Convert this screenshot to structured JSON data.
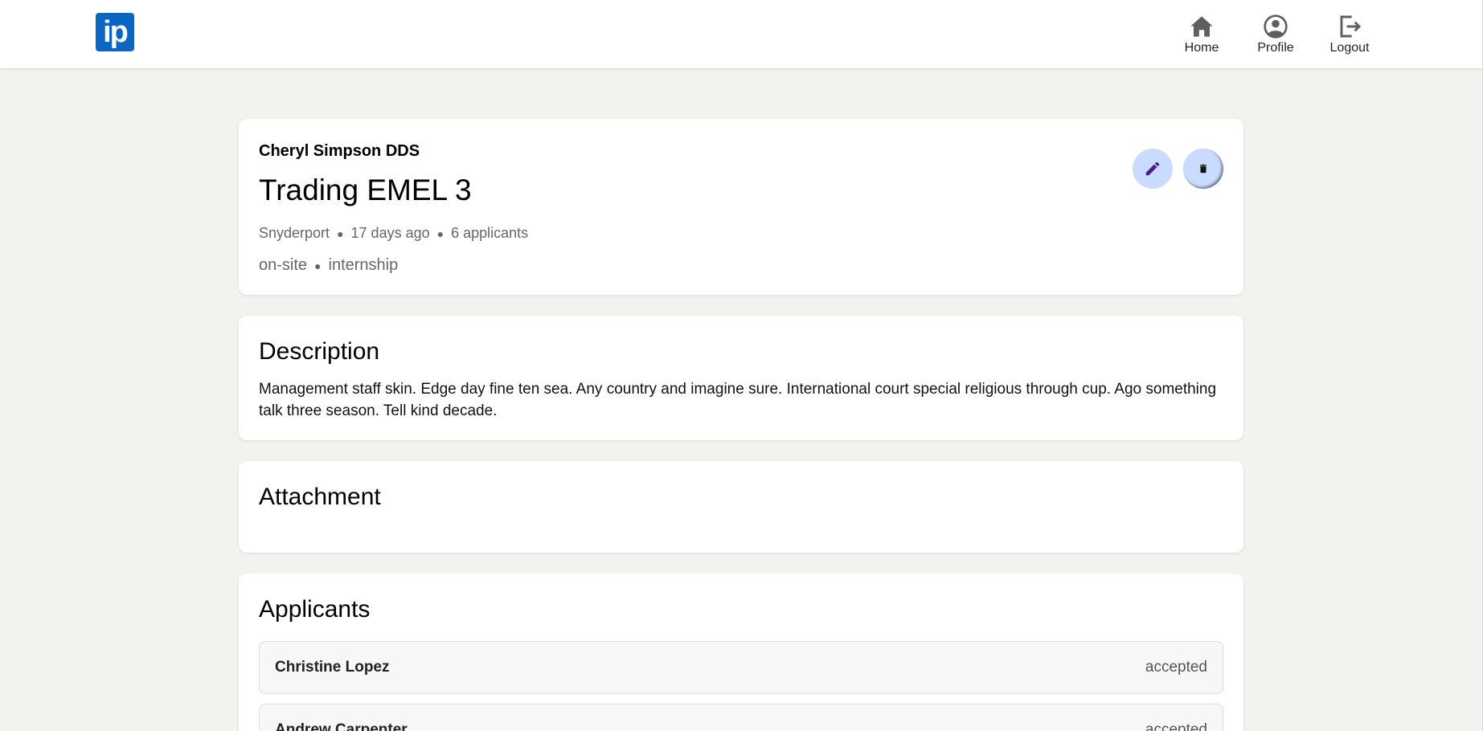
{
  "header": {
    "logo_text": "ip",
    "nav": [
      {
        "label": "Home",
        "icon": "home-icon"
      },
      {
        "label": "Profile",
        "icon": "profile-icon"
      },
      {
        "label": "Logout",
        "icon": "logout-icon"
      }
    ]
  },
  "job": {
    "company": "Cheryl Simpson DDS",
    "title": "Trading EMEL 3",
    "location": "Snyderport",
    "posted": "17 days ago",
    "applicants_count": "6 applicants",
    "workplace": "on-site",
    "type": "internship",
    "actions": {
      "edit_icon": "pencil-icon",
      "delete_icon": "trash-icon"
    }
  },
  "description": {
    "title": "Description",
    "text": "Management staff skin. Edge day fine ten sea. Any country and imagine sure. International court special religious through cup. Ago something talk three season. Tell kind decade."
  },
  "attachment": {
    "title": "Attachment"
  },
  "applicants": {
    "title": "Applicants",
    "list": [
      {
        "name": "Christine Lopez",
        "status": "accepted"
      },
      {
        "name": "Andrew Carpenter",
        "status": "accepted"
      }
    ]
  },
  "colors": {
    "brand": "#0a66c2",
    "background": "#f3f2ef",
    "action_button": "#c9dcff",
    "edit_icon": "#4a1a8c"
  }
}
